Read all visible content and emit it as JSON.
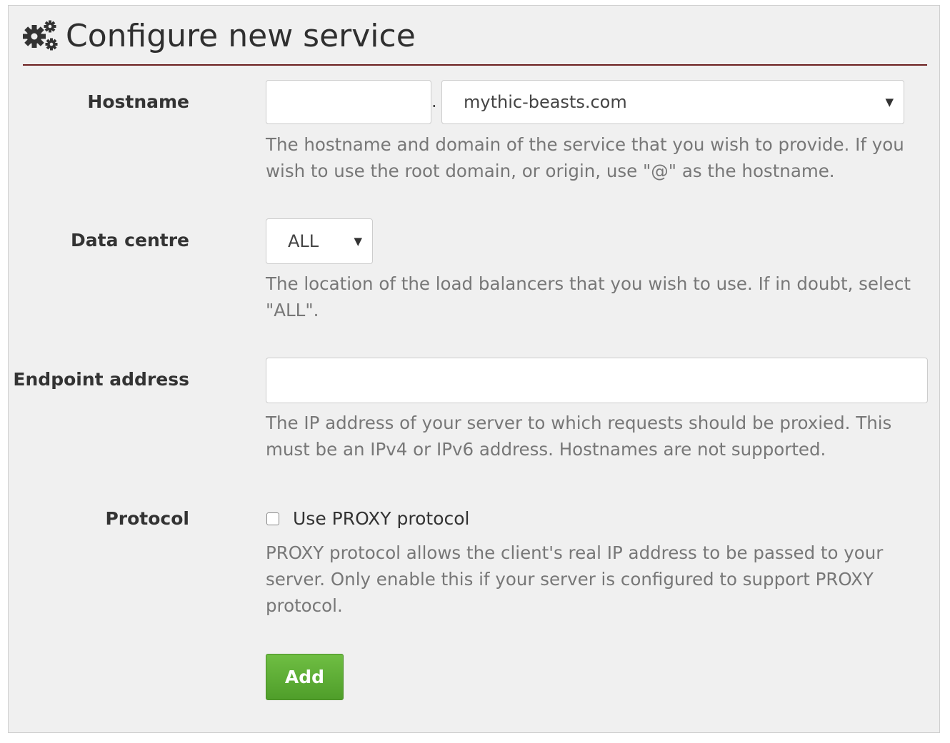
{
  "header": {
    "title": "Configure new service",
    "icon": "gears-icon"
  },
  "form": {
    "hostname": {
      "label": "Hostname",
      "value": "",
      "separator": ".",
      "domain_selected": "mythic-beasts.com",
      "help": "The hostname and domain of the service that you wish to provide. If you wish to use the root domain, or origin, use \"@\" as the hostname."
    },
    "data_centre": {
      "label": "Data centre",
      "selected": "ALL",
      "help": "The location of the load balancers that you wish to use. If in doubt, select \"ALL\"."
    },
    "endpoint": {
      "label": "Endpoint address",
      "value": "",
      "help": "The IP address of your server to which requests should be proxied. This must be an IPv4 or IPv6 address. Hostnames are not supported."
    },
    "protocol": {
      "label": "Protocol",
      "checkbox_label": "Use PROXY protocol",
      "checked": false,
      "help": "PROXY protocol allows the client's real IP address to be passed to your server. Only enable this if your server is configured to support PROXY protocol."
    },
    "submit_label": "Add"
  },
  "colors": {
    "panel_bg": "#f0f0f0",
    "title_rule": "#6b1f1f",
    "help_text": "#777777",
    "add_button": "#5aad33"
  },
  "icons": {
    "title": "gears-icon",
    "select_arrow": "caret-down-icon"
  }
}
